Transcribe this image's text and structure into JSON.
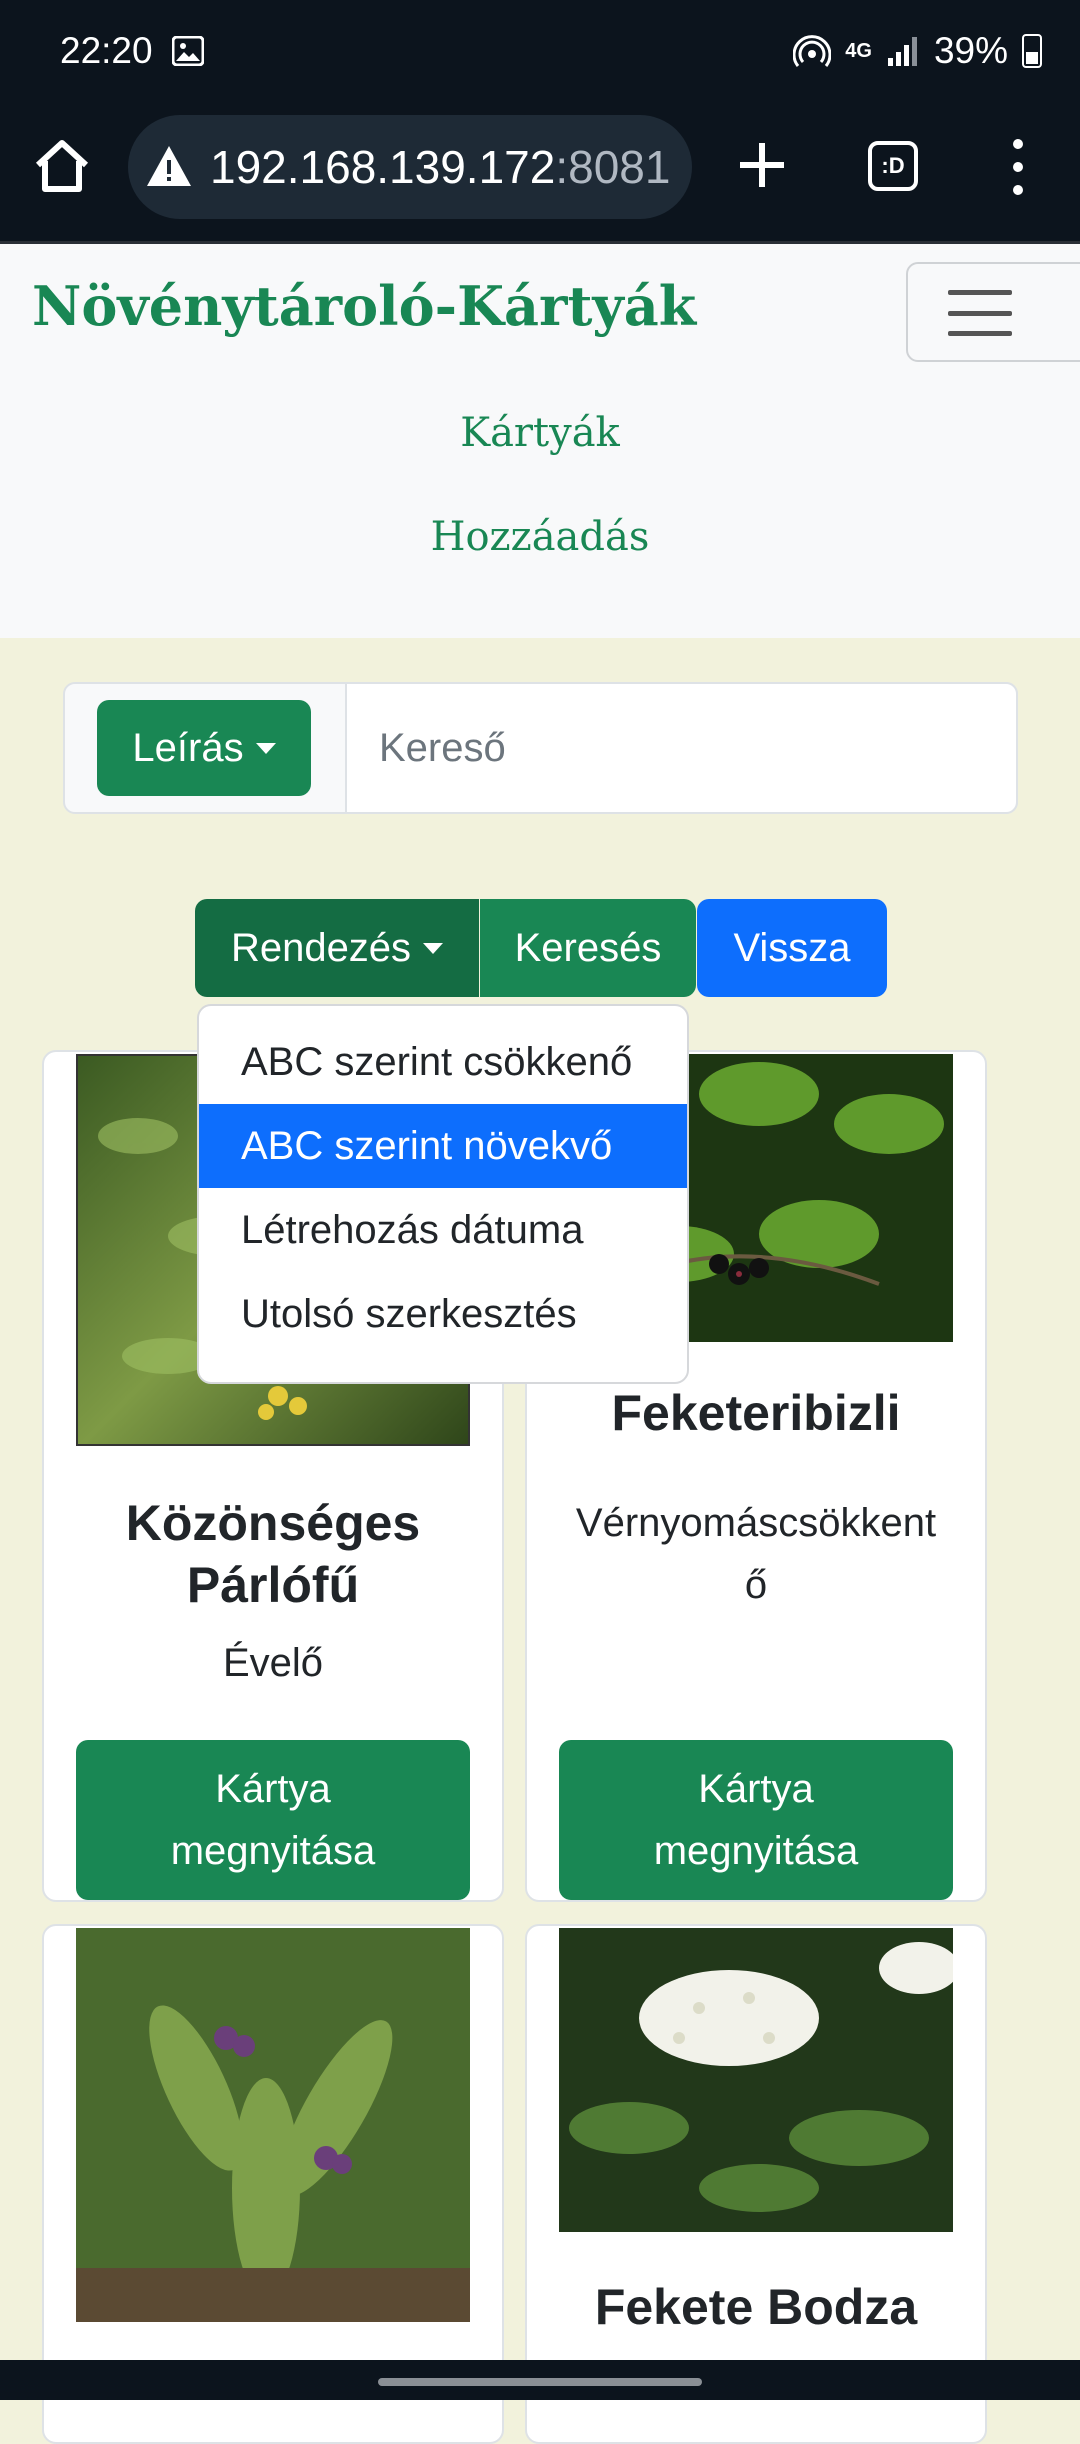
{
  "status_bar": {
    "time": "22:20",
    "network": "4G",
    "battery": "39%"
  },
  "browser": {
    "url_host": "192.168.139.172",
    "url_port": ":8081",
    "tab_indicator": ":D"
  },
  "navbar": {
    "brand": "Növénytároló-Kártyák",
    "links": [
      "Kártyák",
      "Hozzáadás"
    ]
  },
  "search": {
    "filter_label": "Leírás",
    "placeholder": "Kereső"
  },
  "actions": {
    "sort_label": "Rendezés",
    "search_label": "Keresés",
    "back_label": "Vissza"
  },
  "sort_menu": {
    "options": [
      "ABC szerint csökkenő",
      "ABC szerint növekvő",
      "Létrehozás dátuma",
      "Utolsó szerkesztés"
    ],
    "selected": "ABC szerint növekvő"
  },
  "cards": [
    {
      "title": "Közönséges Párlófű",
      "description": "Évelő",
      "button": "Kártya megnyitása"
    },
    {
      "title": "Feketeribizli",
      "description": "Vérnyomáscsökkentő",
      "button": "Kártya megnyitása"
    },
    {
      "title": "",
      "description": "",
      "button": ""
    },
    {
      "title": "Fekete Bodza",
      "description": "",
      "button": ""
    }
  ],
  "colors": {
    "primary_green": "#198754",
    "dark_green": "#146c43",
    "blue": "#0d6efd",
    "page_bg": "#f2f2dc"
  },
  "icons": [
    "image-icon",
    "hotspot-icon",
    "signal-icon",
    "battery-icon",
    "home-icon",
    "warning-icon",
    "plus-icon",
    "tabs-icon",
    "more-vert-icon",
    "hamburger-icon"
  ]
}
